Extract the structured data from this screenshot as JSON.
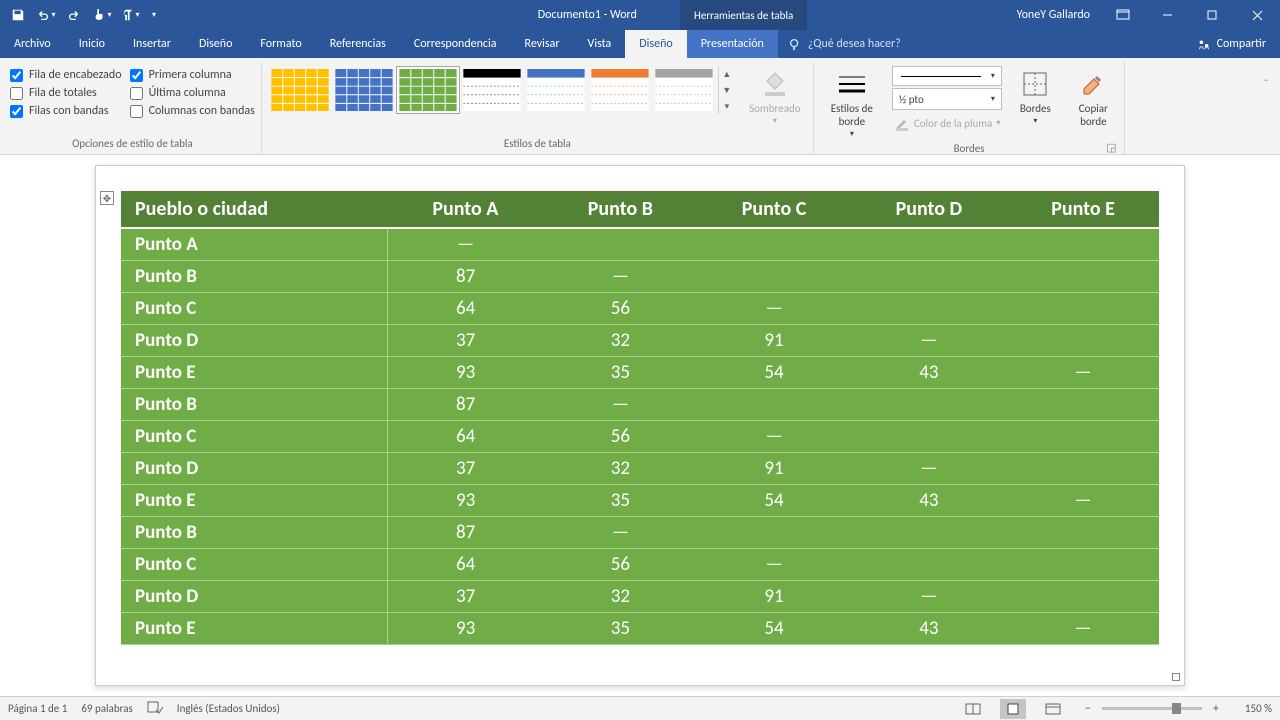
{
  "title": {
    "doc": "Documento1 - Word",
    "tools": "Herramientas de tabla",
    "user": "YoneY Gallardo"
  },
  "qat": {
    "save": "💾",
    "undo": "↶",
    "redo": "↻",
    "touch": "👆",
    "style": "¶"
  },
  "tabs": {
    "file": "Archivo",
    "home": "Inicio",
    "insert": "Insertar",
    "design": "Diseño",
    "layout": "Formato",
    "references": "Referencias",
    "mailings": "Correspondencia",
    "review": "Revisar",
    "view": "Vista",
    "tdesign": "Diseño",
    "tlayout": "Presentación",
    "tell_placeholder": "¿Qué desea hacer?",
    "share": "Compartir"
  },
  "ribbon": {
    "opts": {
      "header_row": "Fila de encabezado",
      "total_row": "Fila de totales",
      "banded_rows": "Filas con bandas",
      "first_col": "Primera columna",
      "last_col": "Última columna",
      "banded_cols": "Columnas con bandas",
      "group": "Opciones de estilo de tabla"
    },
    "styles_group": "Estilos de tabla",
    "shading": "Sombreado",
    "border_styles": "Estilos de borde",
    "pen_weight": "½ pto",
    "pen_color": "Color de la pluma",
    "borders": "Bordes",
    "painter": "Copiar borde",
    "borders_group": "Bordes"
  },
  "table": {
    "headers": [
      "Pueblo o ciudad",
      "Punto A",
      "Punto B",
      "Punto C",
      "Punto D",
      "Punto E"
    ],
    "rows": [
      [
        "Punto A",
        "—",
        "",
        "",
        "",
        ""
      ],
      [
        "Punto B",
        "87",
        "—",
        "",
        "",
        ""
      ],
      [
        "Punto C",
        "64",
        "56",
        "—",
        "",
        ""
      ],
      [
        "Punto D",
        "37",
        "32",
        "91",
        "—",
        ""
      ],
      [
        "Punto E",
        "93",
        "35",
        "54",
        "43",
        "—"
      ],
      [
        "Punto B",
        "87",
        "—",
        "",
        "",
        ""
      ],
      [
        "Punto C",
        "64",
        "56",
        "—",
        "",
        ""
      ],
      [
        "Punto D",
        "37",
        "32",
        "91",
        "—",
        ""
      ],
      [
        "Punto E",
        "93",
        "35",
        "54",
        "43",
        "—"
      ],
      [
        "Punto B",
        "87",
        "—",
        "",
        "",
        ""
      ],
      [
        "Punto C",
        "64",
        "56",
        "—",
        "",
        ""
      ],
      [
        "Punto D",
        "37",
        "32",
        "91",
        "—",
        ""
      ],
      [
        "Punto E",
        "93",
        "35",
        "54",
        "43",
        "—"
      ]
    ]
  },
  "status": {
    "page": "Página 1 de 1",
    "words": "69 palabras",
    "lang": "Inglés (Estados Unidos)",
    "zoom": "150 %"
  }
}
